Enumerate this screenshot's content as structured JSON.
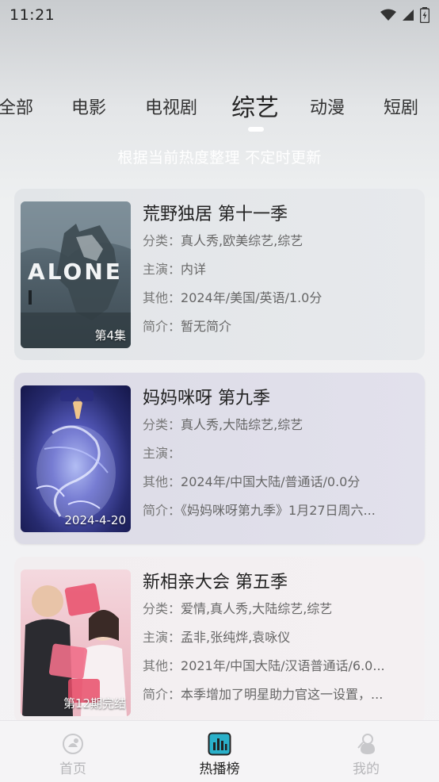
{
  "status_bar": {
    "time": "11:21"
  },
  "tabs": [
    {
      "label": "全部",
      "active": false
    },
    {
      "label": "电影",
      "active": false
    },
    {
      "label": "电视剧",
      "active": false
    },
    {
      "label": "综艺",
      "active": true
    },
    {
      "label": "动漫",
      "active": false
    },
    {
      "label": "短剧",
      "active": false
    }
  ],
  "subtitle": "根据当前热度整理 不定时更新",
  "cards": [
    {
      "title": "荒野独居 第十一季",
      "category_key": "分类：",
      "category": "真人秀,欧美综艺,综艺",
      "cast_key": "主演：",
      "cast": "内详",
      "other_key": "其他：",
      "other": "2024年/美国/英语/1.0分",
      "intro_key": "简介：",
      "intro": "暂无简介",
      "badge": "第4集",
      "poster_text": "ALONE"
    },
    {
      "title": "妈妈咪呀 第九季",
      "category_key": "分类：",
      "category": "真人秀,大陆综艺,综艺",
      "cast_key": "主演：",
      "cast": "",
      "other_key": "其他：",
      "other": "2024年/中国大陆/普通话/0.0分",
      "intro_key": "简介：",
      "intro": "《妈妈咪呀第九季》1月27日周六...",
      "badge": "2024-4-20"
    },
    {
      "title": "新相亲大会 第五季",
      "category_key": "分类：",
      "category": "爱情,真人秀,大陆综艺,综艺",
      "cast_key": "主演：",
      "cast": "孟非,张纯烨,袁咏仪",
      "other_key": "其他：",
      "other": "2021年/中国大陆/汉语普通话/6.0...",
      "intro_key": "简介：",
      "intro": "本季增加了明星助力官这一设置，...",
      "badge": "第12期完结"
    }
  ],
  "bottom_nav": [
    {
      "label": "首页",
      "icon": "home-icon",
      "active": false
    },
    {
      "label": "热播榜",
      "icon": "chart-icon",
      "active": true
    },
    {
      "label": "我的",
      "icon": "profile-icon",
      "active": false
    }
  ],
  "colors": {
    "accent": "#2ab0c9",
    "inactive_nav": "#b6b6b9"
  }
}
